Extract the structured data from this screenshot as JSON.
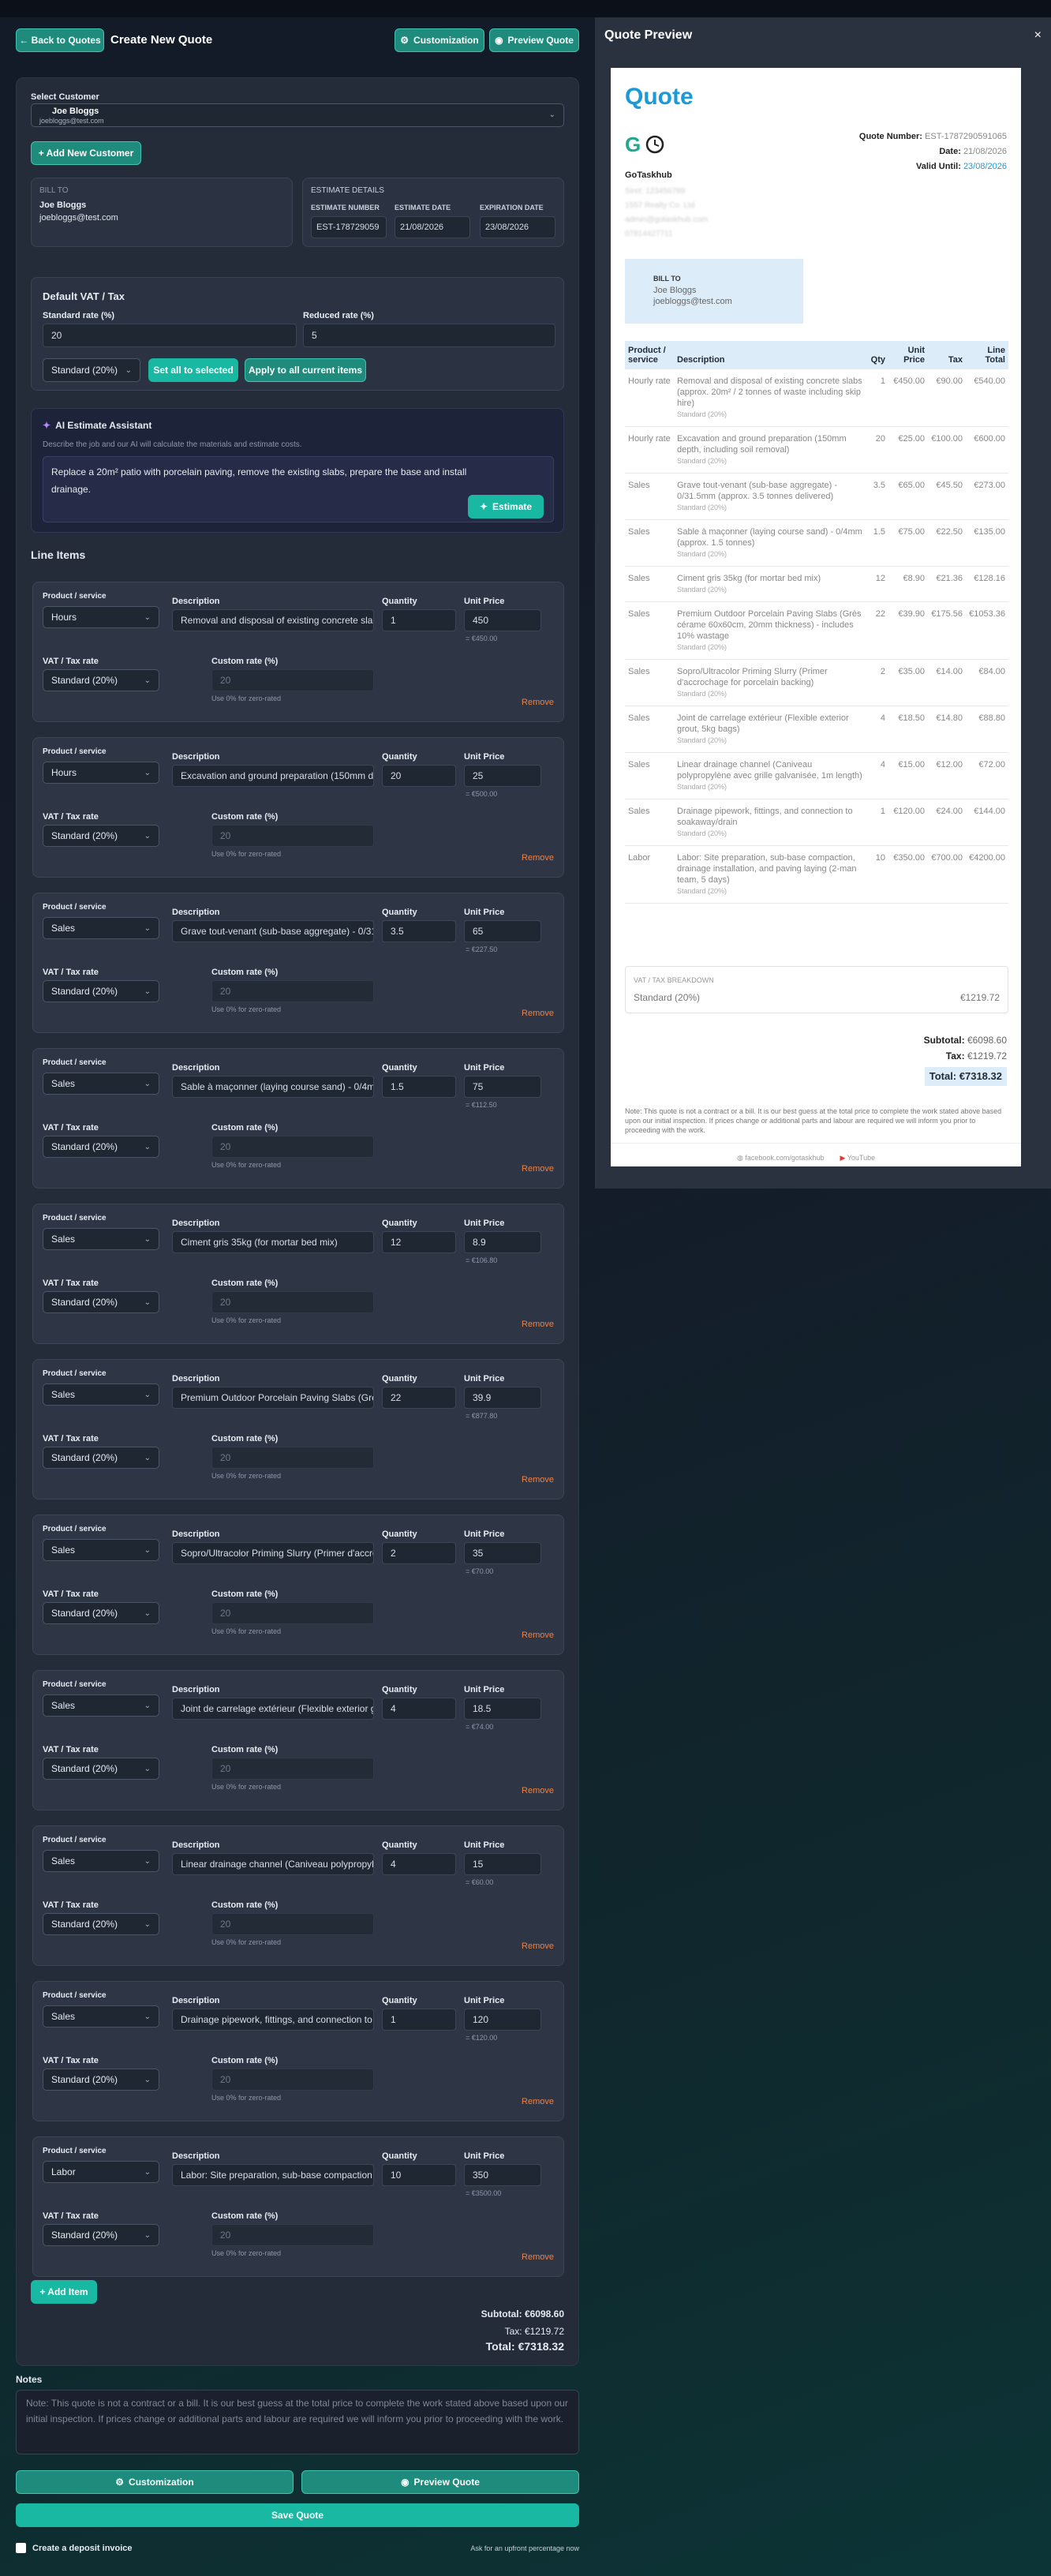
{
  "header": {
    "back_label": "← Back to Quotes",
    "title": "Create New Quote",
    "customization_label": "Customization",
    "preview_label": "Preview Quote"
  },
  "customer": {
    "label": "Select Customer",
    "name": "Joe Bloggs",
    "email": "joebloggs@test.com",
    "add_label": "+ Add New Customer"
  },
  "bill_to": {
    "label": "BILL TO",
    "name": "Joe Bloggs",
    "email": "joebloggs@test.com"
  },
  "estimate": {
    "label": "ESTIMATE DETAILS",
    "number_label": "ESTIMATE NUMBER",
    "number": "EST-178729059",
    "date_label": "ESTIMATE DATE",
    "date": "21/08/2026",
    "exp_label": "EXPIRATION DATE",
    "exp": "23/08/2026"
  },
  "vat": {
    "title": "Default VAT / Tax",
    "standard_label": "Standard rate (%)",
    "standard": "20",
    "reduced_label": "Reduced rate (%)",
    "reduced": "5",
    "select": "Standard (20%)",
    "set_all": "Set all to selected",
    "apply_all": "Apply to all current items"
  },
  "ai": {
    "title": "AI Estimate Assistant",
    "desc": "Describe the job and our AI will calculate the materials and estimate costs.",
    "prompt": "Replace a 20m² patio with porcelain paving, remove the existing slabs, prepare the base and install drainage.",
    "button": "Estimate"
  },
  "line_items_title": "Line Items",
  "labels": {
    "product": "Product / service",
    "description": "Description",
    "quantity": "Quantity",
    "unit_price": "Unit Price",
    "vat": "VAT / Tax rate",
    "custom": "Custom rate (%)",
    "custom_placeholder": "20",
    "zero_hint": "Use 0% for zero-rated",
    "remove": "Remove"
  },
  "items": [
    {
      "product": "Hours",
      "desc": "Removal and disposal of existing concrete slabs (approx. 20m² / 2 tonnes of waste including skip hire)",
      "qty": "1",
      "price": "450",
      "total": "= €450.00",
      "vat": "Standard (20%)"
    },
    {
      "product": "Hours",
      "desc": "Excavation and ground preparation (150mm depth, including soil removal)",
      "qty": "20",
      "price": "25",
      "total": "= €500.00",
      "vat": "Standard (20%)"
    },
    {
      "product": "Sales",
      "desc": "Grave tout-venant (sub-base aggregate) - 0/31.5mm (approx. 3.5 tonnes delivered)",
      "qty": "3.5",
      "price": "65",
      "total": "= €227.50",
      "vat": "Standard (20%)"
    },
    {
      "product": "Sales",
      "desc": "Sable à maçonner (laying course sand) - 0/4mm (approx. 1.5 tonnes)",
      "qty": "1.5",
      "price": "75",
      "total": "= €112.50",
      "vat": "Standard (20%)"
    },
    {
      "product": "Sales",
      "desc": "Ciment gris 35kg (for mortar bed mix)",
      "qty": "12",
      "price": "8.9",
      "total": "= €106.80",
      "vat": "Standard (20%)"
    },
    {
      "product": "Sales",
      "desc": "Premium Outdoor Porcelain Paving Slabs (Grès cérame 60x60cm, 20mm thickness) - includes 10% wastage",
      "qty": "22",
      "price": "39.9",
      "total": "= €877.80",
      "vat": "Standard (20%)"
    },
    {
      "product": "Sales",
      "desc": "Sopro/Ultracolor Priming Slurry (Primer d'accrochage for porcelain backing)",
      "qty": "2",
      "price": "35",
      "total": "= €70.00",
      "vat": "Standard (20%)"
    },
    {
      "product": "Sales",
      "desc": "Joint de carrelage extérieur (Flexible exterior grout, 5kg bags)",
      "qty": "4",
      "price": "18.5",
      "total": "= €74.00",
      "vat": "Standard (20%)"
    },
    {
      "product": "Sales",
      "desc": "Linear drainage channel (Caniveau polypropylène avec grille galvanisée, 1m length)",
      "qty": "4",
      "price": "15",
      "total": "= €60.00",
      "vat": "Standard (20%)"
    },
    {
      "product": "Sales",
      "desc": "Drainage pipework, fittings, and connection to soakaway/drain",
      "qty": "1",
      "price": "120",
      "total": "= €120.00",
      "vat": "Standard (20%)"
    },
    {
      "product": "Labor",
      "desc": "Labor: Site preparation, sub-base compaction, drainage installation, and paving laying (2-man team, 5 days)",
      "qty": "10",
      "price": "350",
      "total": "= €3500.00",
      "vat": "Standard (20%)"
    }
  ],
  "add_item": "+ Add Item",
  "totals": {
    "subtotal": "Subtotal: €6098.60",
    "tax": "Tax: €1219.72",
    "total": "Total: €7318.32"
  },
  "notes": {
    "label": "Notes",
    "text": "Note: This quote is not a contract or a bill. It is our best guess at the total price to complete the work stated above based upon our initial inspection. If prices change or additional parts and labour are required we will inform you prior to proceeding with the work."
  },
  "footer": {
    "customization": "Customization",
    "preview": "Preview Quote",
    "save": "Save Quote",
    "deposit": "Create a deposit invoice",
    "deposit_hint": "Ask for an upfront percentage now"
  },
  "preview": {
    "title": "Quote Preview",
    "close": "×",
    "doc_title": "Quote",
    "quote_number_label": "Quote Number:",
    "quote_number": "EST-1787290591065",
    "date_label": "Date:",
    "date": "21/08/2026",
    "valid_label": "Valid Until:",
    "valid": "23/08/2026",
    "company": "GoTaskhub",
    "company_lines": [
      "Siret: 123456789",
      "1557 Realty Co. Ltd",
      "admin@gotaskhub.com",
      "07814427711"
    ],
    "bill_label": "BILL TO",
    "bill_name": "Joe Bloggs",
    "bill_email": "joebloggs@test.com",
    "cols": {
      "product": "Product / service",
      "desc": "Description",
      "qty": "Qty",
      "unit": "Unit Price",
      "tax": "Tax",
      "total": "Line Total"
    },
    "rows": [
      {
        "p": "Hourly rate",
        "d": "Removal and disposal of existing concrete slabs (approx. 20m² / 2 tonnes of waste including skip hire)",
        "q": "1",
        "u": "€450.00",
        "t": "€90.00",
        "l": "€540.00"
      },
      {
        "p": "Hourly rate",
        "d": "Excavation and ground preparation (150mm depth, including soil removal)",
        "q": "20",
        "u": "€25.00",
        "t": "€100.00",
        "l": "€600.00"
      },
      {
        "p": "Sales",
        "d": "Grave tout-venant (sub-base aggregate) - 0/31.5mm (approx. 3.5 tonnes delivered)",
        "q": "3.5",
        "u": "€65.00",
        "t": "€45.50",
        "l": "€273.00"
      },
      {
        "p": "Sales",
        "d": "Sable à maçonner (laying course sand) - 0/4mm (approx. 1.5 tonnes)",
        "q": "1.5",
        "u": "€75.00",
        "t": "€22.50",
        "l": "€135.00"
      },
      {
        "p": "Sales",
        "d": "Ciment gris 35kg (for mortar bed mix)",
        "q": "12",
        "u": "€8.90",
        "t": "€21.36",
        "l": "€128.16"
      },
      {
        "p": "Sales",
        "d": "Premium Outdoor Porcelain Paving Slabs (Grès cérame 60x60cm, 20mm thickness) - includes 10% wastage",
        "q": "22",
        "u": "€39.90",
        "t": "€175.56",
        "l": "€1053.36"
      },
      {
        "p": "Sales",
        "d": "Sopro/Ultracolor Priming Slurry (Primer d'accrochage for porcelain backing)",
        "q": "2",
        "u": "€35.00",
        "t": "€14.00",
        "l": "€84.00"
      },
      {
        "p": "Sales",
        "d": "Joint de carrelage extérieur (Flexible exterior grout, 5kg bags)",
        "q": "4",
        "u": "€18.50",
        "t": "€14.80",
        "l": "€88.80"
      },
      {
        "p": "Sales",
        "d": "Linear drainage channel (Caniveau polypropylène avec grille galvanisée, 1m length)",
        "q": "4",
        "u": "€15.00",
        "t": "€12.00",
        "l": "€72.00"
      },
      {
        "p": "Sales",
        "d": "Drainage pipework, fittings, and connection to soakaway/drain",
        "q": "1",
        "u": "€120.00",
        "t": "€24.00",
        "l": "€144.00"
      },
      {
        "p": "Labor",
        "d": "Labor: Site preparation, sub-base compaction, drainage installation, and paving laying (2-man team, 5 days)",
        "q": "10",
        "u": "€350.00",
        "t": "€700.00",
        "l": "€4200.00"
      }
    ],
    "std": "Standard (20%)",
    "breakdown_label": "VAT / TAX BREAKDOWN",
    "breakdown_name": "Standard (20%)",
    "breakdown_value": "€1219.72",
    "subtotal_label": "Subtotal:",
    "subtotal": "€6098.60",
    "tax_label": "Tax:",
    "tax": "€1219.72",
    "total_label": "Total:",
    "total": "€7318.32",
    "note": "Note: This quote is not a contract or a bill. It is our best guess at the total price to complete the work stated above based upon our initial inspection. If prices change or additional parts and labour are required we will inform you prior to proceeding with the work.",
    "facebook": "facebook.com/gotaskhub",
    "youtube": "YouTube"
  },
  "colors": {
    "accent": "#19b8a2",
    "preview_blue": "#1a9ad6",
    "remove": "#f08040"
  }
}
